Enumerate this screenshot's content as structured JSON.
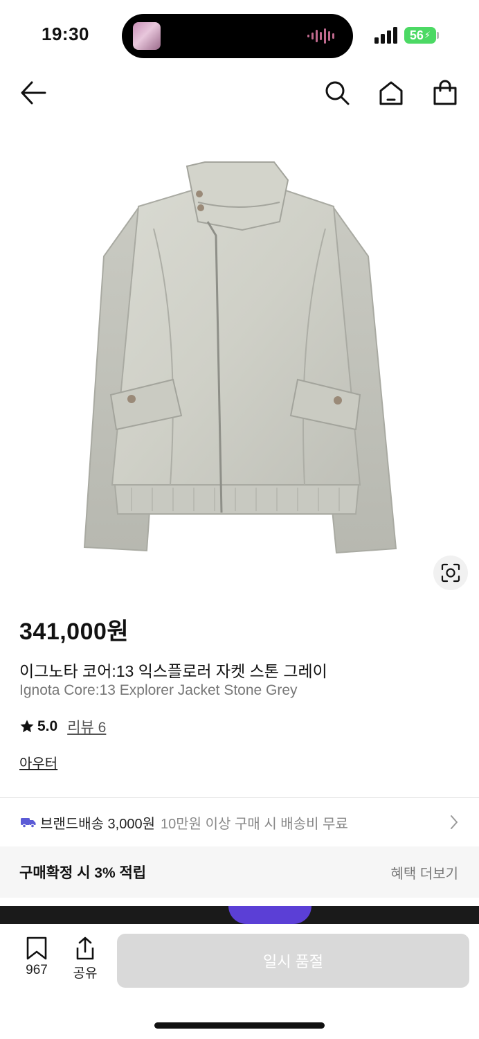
{
  "status_bar": {
    "time": "19:30",
    "battery": "56"
  },
  "nav": {
    "back_icon": "arrow-left-icon",
    "search_icon": "search-icon",
    "home_icon": "home-icon",
    "cart_icon": "shopping-bag-icon"
  },
  "product": {
    "image_alt": "jacket",
    "price": "341,000원",
    "name_ko": "이그노타 코어:13 익스플로러 자켓 스톤 그레이",
    "name_en": "Ignota Core:13 Explorer Jacket Stone Grey",
    "rating": "5.0",
    "review_label": "리뷰 6",
    "category": "아우터"
  },
  "shipping": {
    "main": "브랜드배송 3,000원",
    "sub": "10만원 이상 구매 시 배송비 무료"
  },
  "benefit": {
    "title": "구매확정 시 3% 적립",
    "more": "혜택 더보기"
  },
  "bottom_bar": {
    "bookmark_count": "967",
    "share_label": "공유",
    "cta_label": "일시 품절"
  },
  "colors": {
    "accent_truck": "#5b5bd6",
    "battery": "#4cd964",
    "cta_disabled": "#d9d9d9"
  }
}
